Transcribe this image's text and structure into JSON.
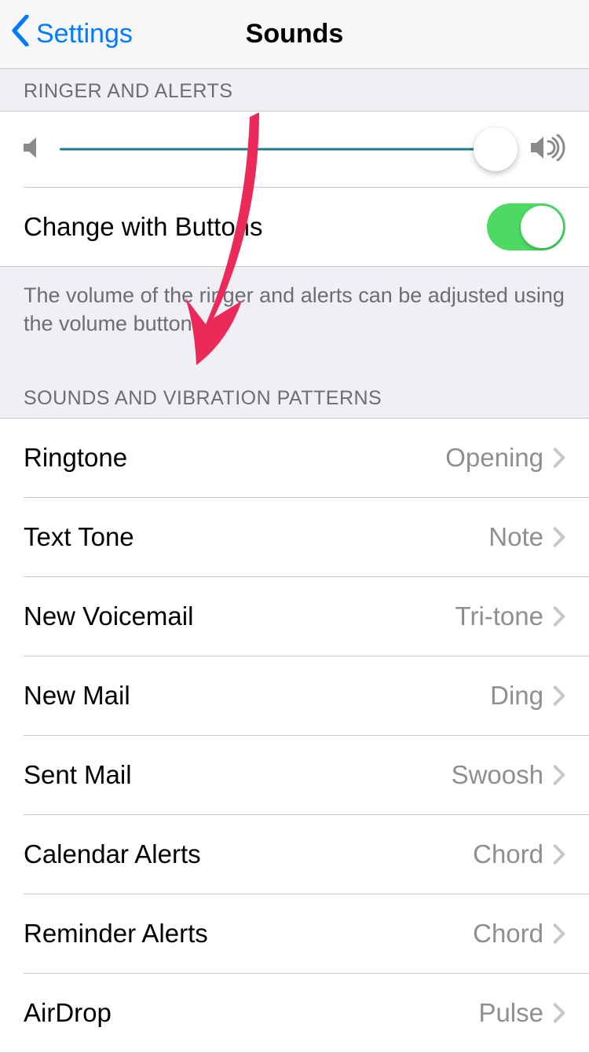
{
  "nav": {
    "back_label": "Settings",
    "title": "Sounds"
  },
  "ringer": {
    "header": "Ringer and Alerts",
    "volume_percent": 96,
    "change_label": "Change with Buttons",
    "change_on": true,
    "footer_text": "The volume of the ringer and alerts can be adjusted using the volume buttons."
  },
  "patterns": {
    "header": "Sounds and Vibration Patterns",
    "items": [
      {
        "label": "Ringtone",
        "value": "Opening"
      },
      {
        "label": "Text Tone",
        "value": "Note"
      },
      {
        "label": "New Voicemail",
        "value": "Tri-tone"
      },
      {
        "label": "New Mail",
        "value": "Ding"
      },
      {
        "label": "Sent Mail",
        "value": "Swoosh"
      },
      {
        "label": "Calendar Alerts",
        "value": "Chord"
      },
      {
        "label": "Reminder Alerts",
        "value": "Chord"
      },
      {
        "label": "AirDrop",
        "value": "Pulse"
      }
    ]
  },
  "colors": {
    "tint": "#007aff",
    "slider_fill": "#1f7a89",
    "toggle_on": "#4cd964",
    "arrow": "#eb2a5a"
  }
}
